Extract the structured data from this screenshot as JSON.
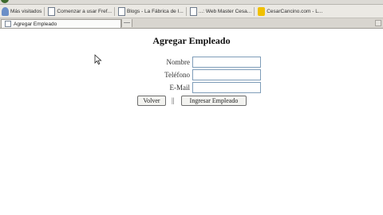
{
  "browser": {
    "bookmarks": [
      {
        "label": "Más visitados",
        "icon": "person-icon"
      },
      {
        "label": "Comenzar a usar Fref...",
        "icon": "page-icon"
      },
      {
        "label": "Blogs - La Fábrica de I...",
        "icon": "page-icon"
      },
      {
        "label": "...: Web Master Cesa...",
        "icon": "page-icon"
      },
      {
        "label": "CesarCancino.com - L...",
        "icon": "star-icon"
      }
    ],
    "tab": {
      "label": "Agregar Empleado",
      "icon": "page-icon"
    }
  },
  "form": {
    "title": "Agregar Empleado",
    "fields": [
      {
        "label": "Nombre",
        "value": ""
      },
      {
        "label": "Teléfono",
        "value": ""
      },
      {
        "label": "E-Mail",
        "value": ""
      }
    ],
    "back_button": "Volver",
    "separator": "||",
    "submit_button": "Ingresar Empleado"
  },
  "colors": {
    "field_border": "#7f9db9",
    "chrome": "#ebe9e4"
  }
}
